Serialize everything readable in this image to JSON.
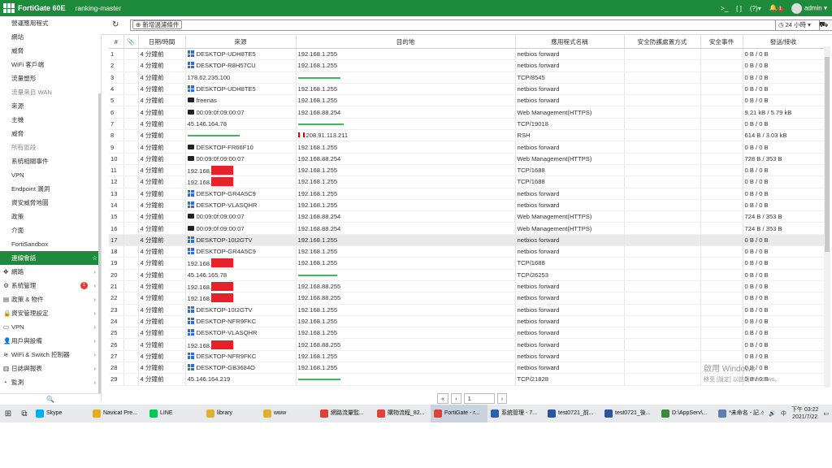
{
  "topbar": {
    "brand": "FortiGate 60E",
    "hostname": "ranking-master",
    "terminal_icon": ">_",
    "fullscreen_icon": "[ ]",
    "help_icon": "?",
    "bell_badge": "1",
    "user": "admin"
  },
  "sidebar": {
    "items": [
      {
        "label": "營運應用程式",
        "kind": "sub"
      },
      {
        "label": "網站",
        "kind": "sub"
      },
      {
        "label": "威脅",
        "kind": "sub"
      },
      {
        "label": "WiFi 客戶端",
        "kind": "sub"
      },
      {
        "label": "流量塑形",
        "kind": "sub"
      },
      {
        "label": "流量來自 WAN",
        "kind": "group"
      },
      {
        "label": "來源",
        "kind": "sub"
      },
      {
        "label": "主機",
        "kind": "sub"
      },
      {
        "label": "威脅",
        "kind": "sub"
      },
      {
        "label": "所有區段",
        "kind": "group"
      },
      {
        "label": "系統相關事件",
        "kind": "sub"
      },
      {
        "label": "VPN",
        "kind": "sub"
      },
      {
        "label": "Endpoint 漏洞",
        "kind": "sub"
      },
      {
        "label": "資安威脅地圖",
        "kind": "sub"
      },
      {
        "label": "政策",
        "kind": "sub"
      },
      {
        "label": "介面",
        "kind": "sub"
      },
      {
        "label": "FortiSandbox",
        "kind": "sub"
      },
      {
        "label": "連線會話",
        "kind": "active"
      }
    ],
    "sections": [
      {
        "label": "網路",
        "icon": "network-icon"
      },
      {
        "label": "系統管理",
        "icon": "gear-icon",
        "badge": "1"
      },
      {
        "label": "政策 & 物件",
        "icon": "policy-icon"
      },
      {
        "label": "資安管理設定",
        "icon": "lock-icon"
      },
      {
        "label": "VPN",
        "icon": "monitor-icon"
      },
      {
        "label": "用戶與設備",
        "icon": "user-icon"
      },
      {
        "label": "WiFi & Switch 控制器",
        "icon": "wifi-icon"
      },
      {
        "label": "日誌與報表",
        "icon": "chart-icon"
      },
      {
        "label": "監測",
        "icon": "monitor-gauge-icon"
      }
    ]
  },
  "toolbar": {
    "add_filter_label": "新增過濾條件",
    "time_range": "24 小時",
    "refresh_icon": "↻"
  },
  "table": {
    "headers": [
      "#",
      "",
      "日期/時間",
      "來源",
      "目的地",
      "應用程式名稱",
      "安全防護處置方式",
      "安全事件",
      "發送/接收"
    ],
    "rows": [
      {
        "n": "1",
        "t": "4 分鐘前",
        "src": "DESKTOP-UDH8TE5",
        "si": "win",
        "dst": "192.168.1.255",
        "app": "netbios forward",
        "tx": "0 B / 0 B"
      },
      {
        "n": "2",
        "t": "4 分鐘前",
        "src": "DESKTOP-R8H57CU",
        "si": "win",
        "dst": "192.168.1.255",
        "app": "netbios forward",
        "tx": "0 B / 0 B"
      },
      {
        "n": "3",
        "t": "4 分鐘前",
        "src": "178.62.235.100",
        "si": "",
        "dst": "",
        "db": "52",
        "app": "TCP/8545",
        "tx": "0 B / 0 B"
      },
      {
        "n": "4",
        "t": "4 分鐘前",
        "src": "DESKTOP-UDH8TE5",
        "si": "win",
        "dst": "192.168.1.255",
        "app": "netbios forward",
        "tx": "0 B / 0 B"
      },
      {
        "n": "5",
        "t": "4 分鐘前",
        "src": "freenas",
        "si": "dev",
        "dst": "192.168.1.255",
        "app": "netbios forward",
        "tx": "0 B / 0 B"
      },
      {
        "n": "6",
        "t": "4 分鐘前",
        "src": "00:09:0f:09:00:07",
        "si": "dev",
        "dst": "192.168.88.254",
        "app": "Web Management(HTTPS)",
        "tx": "9.21 kB / 5.79 kB"
      },
      {
        "n": "7",
        "t": "4 分鐘前",
        "src": "45.146.164.78",
        "si": "",
        "dst": "",
        "db": "56",
        "app": "TCP/19018",
        "tx": "0 B / 0 B"
      },
      {
        "n": "8",
        "t": "4 分鐘前",
        "src": "",
        "sb": "64",
        "si": "",
        "dst": "208.91.113.211",
        "df": "1",
        "app": "RSH",
        "tx": "614 B / 3.03 kB"
      },
      {
        "n": "9",
        "t": "4 分鐘前",
        "src": "DESKTOP-FR66F10",
        "si": "dev",
        "dst": "192.168.1.255",
        "app": "netbios forward",
        "tx": "0 B / 0 B"
      },
      {
        "n": "10",
        "t": "4 分鐘前",
        "src": "00:09:0f:09:00:07",
        "si": "dev",
        "dst": "192.168.88.254",
        "app": "Web Management(HTTPS)",
        "tx": "728 B / 353 B"
      },
      {
        "n": "11",
        "t": "4 分鐘前",
        "src": "192.168.",
        "sr": "1",
        "si": "",
        "dst": "192.168.1.255",
        "app": "TCP/1688",
        "tx": "0 B / 0 B"
      },
      {
        "n": "12",
        "t": "4 分鐘前",
        "src": "192.168.",
        "sr": "1",
        "si": "",
        "dst": "192.168.1.255",
        "app": "TCP/1688",
        "tx": "0 B / 0 B"
      },
      {
        "n": "13",
        "t": "4 分鐘前",
        "src": "DESKTOP-GR4A5C9",
        "si": "win",
        "dst": "192.168.1.255",
        "app": "netbios forward",
        "tx": "0 B / 0 B"
      },
      {
        "n": "14",
        "t": "4 分鐘前",
        "src": "DESKTOP-VLASQHR",
        "si": "win",
        "dst": "192.168.1.255",
        "app": "netbios forward",
        "tx": "0 B / 0 B"
      },
      {
        "n": "15",
        "t": "4 分鐘前",
        "src": "00:09:0f:09:00:07",
        "si": "dev",
        "dst": "192.168.88.254",
        "app": "Web Management(HTTPS)",
        "tx": "724 B / 353 B"
      },
      {
        "n": "16",
        "t": "4 分鐘前",
        "src": "00:09:0f:09:00:07",
        "si": "dev",
        "dst": "192.168.88.254",
        "app": "Web Management(HTTPS)",
        "tx": "724 B / 353 B"
      },
      {
        "n": "17",
        "t": "4 分鐘前",
        "src": "DESKTOP-10I2GTV",
        "si": "win",
        "dst": "192.168.1.255",
        "app": "netbios forward",
        "tx": "0 B / 0 B",
        "hl": "1"
      },
      {
        "n": "18",
        "t": "4 分鐘前",
        "src": "DESKTOP-GR4A5C9",
        "si": "win",
        "dst": "192.168.1.255",
        "app": "netbios forward",
        "tx": "0 B / 0 B"
      },
      {
        "n": "19",
        "t": "4 分鐘前",
        "src": "192.168.",
        "sr": "1",
        "si": "",
        "dst": "192.168.1.255",
        "app": "TCP/1688",
        "tx": "0 B / 0 B"
      },
      {
        "n": "20",
        "t": "4 分鐘前",
        "src": "45.146.165.78",
        "si": "",
        "dst": "",
        "db": "48",
        "app": "TCP/26253",
        "tx": "0 B / 0 B"
      },
      {
        "n": "21",
        "t": "4 分鐘前",
        "src": "192.168.",
        "sr": "1",
        "si": "",
        "dst": "192.168.88.255",
        "app": "netbios forward",
        "tx": "0 B / 0 B"
      },
      {
        "n": "22",
        "t": "4 分鐘前",
        "src": "192.168.",
        "sr": "1",
        "si": "",
        "dst": "192.168.88.255",
        "app": "netbios forward",
        "tx": "0 B / 0 B"
      },
      {
        "n": "23",
        "t": "4 分鐘前",
        "src": "DESKTOP-10I2GTV",
        "si": "win",
        "dst": "192.168.1.255",
        "app": "netbios forward",
        "tx": "0 B / 0 B"
      },
      {
        "n": "24",
        "t": "4 分鐘前",
        "src": "DESKTOP-NFR9FKC",
        "si": "win",
        "dst": "192.168.1.255",
        "app": "netbios forward",
        "tx": "0 B / 0 B"
      },
      {
        "n": "25",
        "t": "4 分鐘前",
        "src": "DESKTOP-VLASQHR",
        "si": "win",
        "dst": "192.168.1.255",
        "app": "netbios forward",
        "tx": "0 B / 0 B"
      },
      {
        "n": "26",
        "t": "4 分鐘前",
        "src": "192.168.",
        "sr": "1",
        "si": "",
        "dst": "192.168.88.255",
        "app": "netbios forward",
        "tx": "0 B / 0 B"
      },
      {
        "n": "27",
        "t": "4 分鐘前",
        "src": "DESKTOP-NFR9FKC",
        "si": "win",
        "dst": "192.168.1.255",
        "app": "netbios forward",
        "tx": "0 B / 0 B"
      },
      {
        "n": "28",
        "t": "4 分鐘前",
        "src": "DESKTOP-GB3684O",
        "si": "win",
        "dst": "192.168.1.255",
        "app": "netbios forward",
        "tx": "0 B / 0 B"
      },
      {
        "n": "29",
        "t": "4 分鐘前",
        "src": "45.146.164.219",
        "si": "",
        "dst": "",
        "db": "52",
        "app": "TCP/21828",
        "tx": "0 B / 0 B"
      }
    ]
  },
  "pager": {
    "page": "1",
    "prev": "«",
    "prev1": "‹",
    "next": "›"
  },
  "watermark": {
    "line1": "啟用 Windows",
    "line2": "移至 [設定] 以啟用 Windows。"
  },
  "taskbar": {
    "items": [
      {
        "label": "Skype",
        "color": "#00aff0"
      },
      {
        "label": "Navicat Pre...",
        "color": "#e0b020"
      },
      {
        "label": "LINE",
        "color": "#06c755"
      },
      {
        "label": "library",
        "color": "#e0b030"
      },
      {
        "label": "www",
        "color": "#e0b030"
      },
      {
        "label": "網路流量監...",
        "color": "#db4437"
      },
      {
        "label": "購物流程_82...",
        "color": "#db4437"
      },
      {
        "label": "FortiGate - r...",
        "color": "#db4437",
        "active": "1"
      },
      {
        "label": "系統管理 - 7...",
        "color": "#2b5fb4"
      },
      {
        "label": "test0721_前...",
        "color": "#2b579a"
      },
      {
        "label": "test0721_後...",
        "color": "#2b579a"
      },
      {
        "label": "D:\\AppServ\\...",
        "color": "#3a8a3a"
      },
      {
        "label": "*未命名 - 記...",
        "color": "#5a7fb0"
      }
    ],
    "time": "下午 03:22",
    "date": "2021/7/22"
  }
}
